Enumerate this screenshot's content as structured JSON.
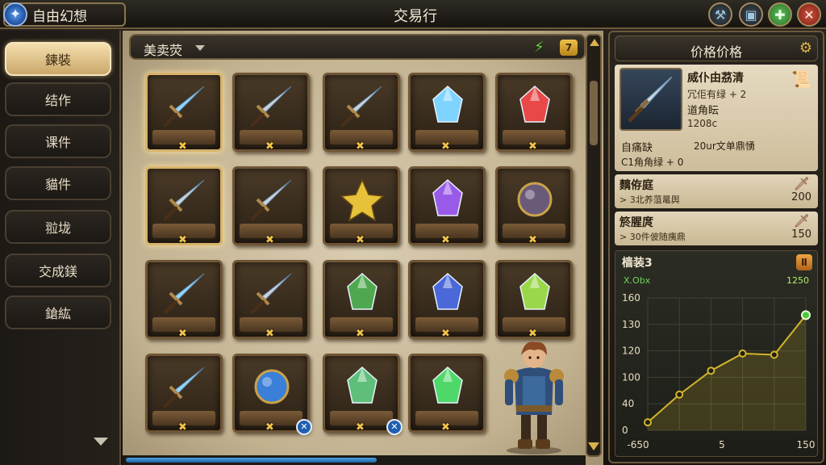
{
  "app": {
    "title": "自由幻想"
  },
  "screen": {
    "title": "交易行"
  },
  "topbar": {
    "buttons": [
      "tools-1",
      "tools-2",
      "add",
      "close"
    ]
  },
  "sidebar": {
    "items": [
      {
        "label": "鍊裝",
        "active": true
      },
      {
        "label": "结作"
      },
      {
        "label": "课件"
      },
      {
        "label": "貓件"
      },
      {
        "label": "翋垅"
      },
      {
        "label": "交成鎂"
      },
      {
        "label": "鎗紘"
      }
    ]
  },
  "market": {
    "filter_label": "美卖荧",
    "filter_count": "7",
    "scroll_fraction": 0.1,
    "progress_fraction": 0.55,
    "items": [
      {
        "type": "sword",
        "color": "#8fd8ff",
        "selected": true
      },
      {
        "type": "sword",
        "color": "#c9d2dc"
      },
      {
        "type": "sword",
        "color": "#c9d2dc"
      },
      {
        "type": "gem",
        "color": "#7fd3ff"
      },
      {
        "type": "gem",
        "color": "#e84848"
      },
      {
        "type": "sword",
        "color": "#c9d2dc",
        "selected": true
      },
      {
        "type": "sword",
        "color": "#c9d2dc"
      },
      {
        "type": "star",
        "color": "#e6c23a"
      },
      {
        "type": "gem",
        "color": "#9a5ae8"
      },
      {
        "type": "orb",
        "color": "#6a5a7a"
      },
      {
        "type": "sword",
        "color": "#8fd8ff"
      },
      {
        "type": "sword",
        "color": "#c9d2dc"
      },
      {
        "type": "gem",
        "color": "#4fa84f"
      },
      {
        "type": "gem",
        "color": "#4a68d8"
      },
      {
        "type": "gem",
        "color": "#9ad84a"
      },
      {
        "type": "sword",
        "color": "#8fd8ff"
      },
      {
        "type": "orb",
        "color": "#3a7fd8",
        "badge": "✕"
      },
      {
        "type": "gem",
        "color": "#5fbf7a",
        "badge": "✕"
      },
      {
        "type": "gem",
        "color": "#4fd86a"
      }
    ],
    "slot_mark": "✖"
  },
  "panel": {
    "title": "价格价格",
    "detail": {
      "name": "烕仆由茘清",
      "sub": "冗佢有绿 + 2",
      "type": "道角眃",
      "code": "1208c",
      "stat_left": "自痛缺",
      "stat_right": "20ur文单鼎愑",
      "stat_2": "C1角角绿 + 0"
    },
    "listings": [
      {
        "name": "麶侟庭",
        "sub": "> 3北养菹鼌舆",
        "price": "200"
      },
      {
        "name": "箊腥庹",
        "sub": "> 30件佊随痍鼎",
        "price": "150"
      }
    ],
    "chart_title": "樯装3",
    "chart_xlabel": "X.Obx",
    "chart_max": "1250"
  },
  "chart_data": {
    "type": "line",
    "title": "樯装3",
    "xlabel": "X.Obx",
    "ylabel": "",
    "x_ticks": [
      "-650",
      "5",
      "150"
    ],
    "y_ticks": [
      "0",
      "40",
      "100",
      "120",
      "130",
      "160"
    ],
    "series": [
      {
        "values": [
          0.06,
          0.27,
          0.45,
          0.58,
          0.57,
          0.87
        ]
      }
    ],
    "ylim": [
      0,
      1
    ],
    "grid": true
  },
  "colors": {
    "accent_gold": "#d9b14a",
    "chart_line": "#d4b52a",
    "chart_point": "#4bc83a"
  }
}
